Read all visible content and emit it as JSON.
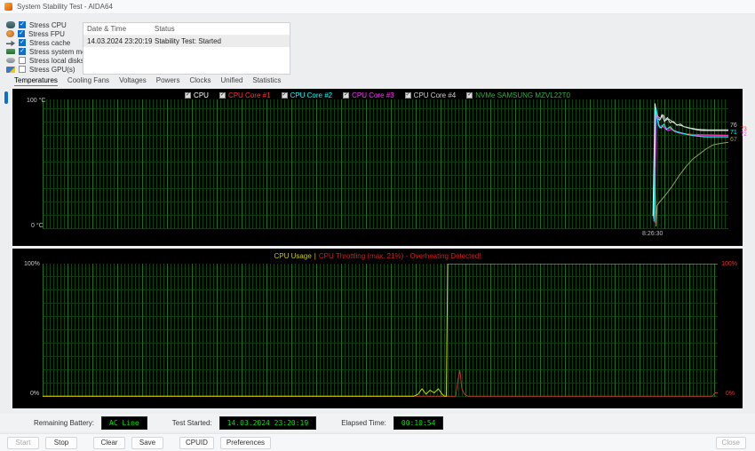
{
  "window": {
    "title": "System Stability Test - AIDA64"
  },
  "colors": {
    "accent": "#0b6fd0",
    "lcd": "#00e400",
    "chart-bg": "#000000"
  },
  "stress_options": [
    {
      "label": "Stress CPU",
      "checked": true,
      "icon": "cpu-icon"
    },
    {
      "label": "Stress FPU",
      "checked": true,
      "icon": "fpu-icon"
    },
    {
      "label": "Stress cache",
      "checked": true,
      "icon": "cache-icon"
    },
    {
      "label": "Stress system memory",
      "checked": true,
      "icon": "memory-icon"
    },
    {
      "label": "Stress local disks",
      "checked": false,
      "icon": "disk-icon"
    },
    {
      "label": "Stress GPU(s)",
      "checked": false,
      "icon": "gpu-icon"
    }
  ],
  "log_table": {
    "columns": [
      "Date & Time",
      "Status"
    ],
    "rows": [
      {
        "datetime": "14.03.2024 23:20:19",
        "status": "Stability Test: Started"
      }
    ]
  },
  "tabs": [
    {
      "label": "Temperatures",
      "active": true
    },
    {
      "label": "Cooling Fans",
      "active": false
    },
    {
      "label": "Voltages",
      "active": false
    },
    {
      "label": "Powers",
      "active": false
    },
    {
      "label": "Clocks",
      "active": false
    },
    {
      "label": "Unified",
      "active": false
    },
    {
      "label": "Statistics",
      "active": false
    }
  ],
  "chart_data": [
    {
      "type": "line",
      "title": "Temperatures",
      "ylabel_top": "100 °C",
      "ylabel_bottom": "0 °C",
      "ylim": [
        0,
        100
      ],
      "grid": true,
      "x_time_label": "8:26:30",
      "x_time_label_frac": 0.893,
      "legend": [
        {
          "name": "CPU",
          "color": "#ffffff",
          "checked": true
        },
        {
          "name": "CPU Core #1",
          "color": "#ff3232",
          "checked": true
        },
        {
          "name": "CPU Core #2",
          "color": "#00ffff",
          "checked": true
        },
        {
          "name": "CPU Core #3",
          "color": "#ff32ff",
          "checked": true
        },
        {
          "name": "CPU Core #4",
          "color": "#cfcfcf",
          "checked": true
        },
        {
          "name": "NVMe SAMSUNG MZVL22T0",
          "color": "#2fae3f",
          "checked": true
        }
      ],
      "current_values": [
        {
          "text": "76",
          "color": "#cfcfcf",
          "x": 808,
          "y": 38,
          "small": false
        },
        {
          "text": "73",
          "color": "#ff3232",
          "x": 820,
          "y": 43,
          "small": true
        },
        {
          "text": "71",
          "color": "#00ffff",
          "x": 808,
          "y": 46,
          "small": false
        },
        {
          "text": "72",
          "color": "#ff32ff",
          "x": 820,
          "y": 49,
          "small": true
        },
        {
          "text": "67",
          "color": "#a39a62",
          "x": 808,
          "y": 54,
          "small": false
        }
      ],
      "series": [
        {
          "name": "CPU",
          "color": "#f0f0f0",
          "points": [
            [
              89.0,
              10
            ],
            [
              89.3,
              97
            ],
            [
              89.6,
              86
            ],
            [
              90.0,
              84
            ],
            [
              90.3,
              88
            ],
            [
              90.7,
              83
            ],
            [
              91.1,
              86
            ],
            [
              91.5,
              82
            ],
            [
              92.0,
              83
            ],
            [
              92.5,
              80
            ],
            [
              93.0,
              81
            ],
            [
              93.5,
              79
            ],
            [
              94.2,
              78
            ],
            [
              95.0,
              77
            ],
            [
              96.0,
              76
            ],
            [
              100,
              76
            ]
          ]
        },
        {
          "name": "CPU Core #4",
          "color": "#cfcfcf",
          "points": [
            [
              89.1,
              8
            ],
            [
              89.35,
              95
            ],
            [
              89.7,
              87
            ],
            [
              90.1,
              85
            ],
            [
              90.5,
              88
            ],
            [
              90.9,
              84
            ],
            [
              91.3,
              85
            ],
            [
              91.8,
              83
            ],
            [
              92.3,
              81
            ],
            [
              92.9,
              80
            ],
            [
              93.6,
              79
            ],
            [
              94.4,
              78
            ],
            [
              95.5,
              77
            ],
            [
              97.0,
              76.5
            ],
            [
              100,
              76.5
            ]
          ]
        },
        {
          "name": "CPU Core #1",
          "color": "#ff3232",
          "points": [
            [
              89.2,
              7
            ],
            [
              89.45,
              90
            ],
            [
              89.9,
              79
            ],
            [
              90.4,
              80
            ],
            [
              90.9,
              77
            ],
            [
              91.5,
              78
            ],
            [
              92.2,
              75
            ],
            [
              93.0,
              74
            ],
            [
              93.8,
              73.5
            ],
            [
              95.0,
              73
            ],
            [
              100,
              72.5
            ]
          ]
        },
        {
          "name": "CPU Core #3",
          "color": "#ff32ff",
          "points": [
            [
              89.25,
              5
            ],
            [
              89.5,
              91
            ],
            [
              90.0,
              78
            ],
            [
              90.5,
              79
            ],
            [
              91.1,
              76
            ],
            [
              91.8,
              77
            ],
            [
              92.5,
              74.5
            ],
            [
              93.4,
              73.5
            ],
            [
              94.5,
              72.5
            ],
            [
              96.0,
              72
            ],
            [
              100,
              72
            ]
          ]
        },
        {
          "name": "CPU Core #2",
          "color": "#00ffff",
          "points": [
            [
              89.15,
              6
            ],
            [
              89.4,
              93
            ],
            [
              89.8,
              80
            ],
            [
              90.2,
              78
            ],
            [
              90.6,
              81
            ],
            [
              91.0,
              77
            ],
            [
              91.5,
              79
            ],
            [
              92.0,
              76
            ],
            [
              92.6,
              75
            ],
            [
              93.3,
              74
            ],
            [
              94.0,
              73
            ],
            [
              95.0,
              72
            ],
            [
              96.5,
              71
            ],
            [
              100,
              71
            ]
          ]
        },
        {
          "name": "NVMe SAMSUNG MZVL22T0",
          "color": "#a39a62",
          "points": [
            [
              89.3,
              48
            ],
            [
              89.45,
              2
            ],
            [
              89.6,
              18
            ],
            [
              90.0,
              21
            ],
            [
              90.8,
              26
            ],
            [
              91.8,
              33
            ],
            [
              92.8,
              41
            ],
            [
              93.8,
              48
            ],
            [
              94.8,
              54
            ],
            [
              95.8,
              58
            ],
            [
              96.8,
              62
            ],
            [
              97.8,
              65
            ],
            [
              98.8,
              66
            ],
            [
              100,
              67
            ]
          ]
        }
      ]
    },
    {
      "type": "line",
      "title_primary": "CPU Usage",
      "title_separator": "|",
      "title_alert": "CPU Throttling (max. 21%) - Overheating Detected!",
      "ylim": [
        0,
        100
      ],
      "grid": true,
      "left_axis": {
        "top": "100%",
        "bottom": "0%"
      },
      "right_axis": {
        "top": "100%",
        "bottom": "0%"
      },
      "series": [
        {
          "name": "CPU Throttling",
          "color": "#c83232",
          "points": [
            [
              0,
              0.5
            ],
            [
              61.2,
              0.5
            ],
            [
              61.5,
              12
            ],
            [
              61.8,
              20
            ],
            [
              62.1,
              6
            ],
            [
              62.5,
              2
            ],
            [
              63.0,
              0.5
            ],
            [
              99.2,
              0.5
            ],
            [
              99.6,
              3
            ],
            [
              100,
              3
            ]
          ]
        },
        {
          "name": "CPU Usage",
          "color": "#d6d600",
          "points": [
            [
              0,
              0.5
            ],
            [
              55.0,
              0.5
            ],
            [
              55.6,
              2
            ],
            [
              56.2,
              6
            ],
            [
              56.8,
              2
            ],
            [
              57.4,
              5
            ],
            [
              58.0,
              3
            ],
            [
              58.6,
              6
            ],
            [
              59.2,
              2
            ],
            [
              59.5,
              0.5
            ],
            [
              59.8,
              0.5
            ],
            [
              60.0,
              100
            ],
            [
              100,
              100
            ]
          ]
        }
      ]
    }
  ],
  "status_bar": {
    "battery_label": "Remaining Battery:",
    "battery_value": "AC Line",
    "test_started_label": "Test Started:",
    "test_started_value": "14.03.2024 23:20:19",
    "elapsed_label": "Elapsed Time:",
    "elapsed_value": "00:10:54"
  },
  "buttons": {
    "start": "Start",
    "stop": "Stop",
    "clear": "Clear",
    "save": "Save",
    "cpuid": "CPUID",
    "preferences": "Preferences",
    "close": "Close"
  }
}
